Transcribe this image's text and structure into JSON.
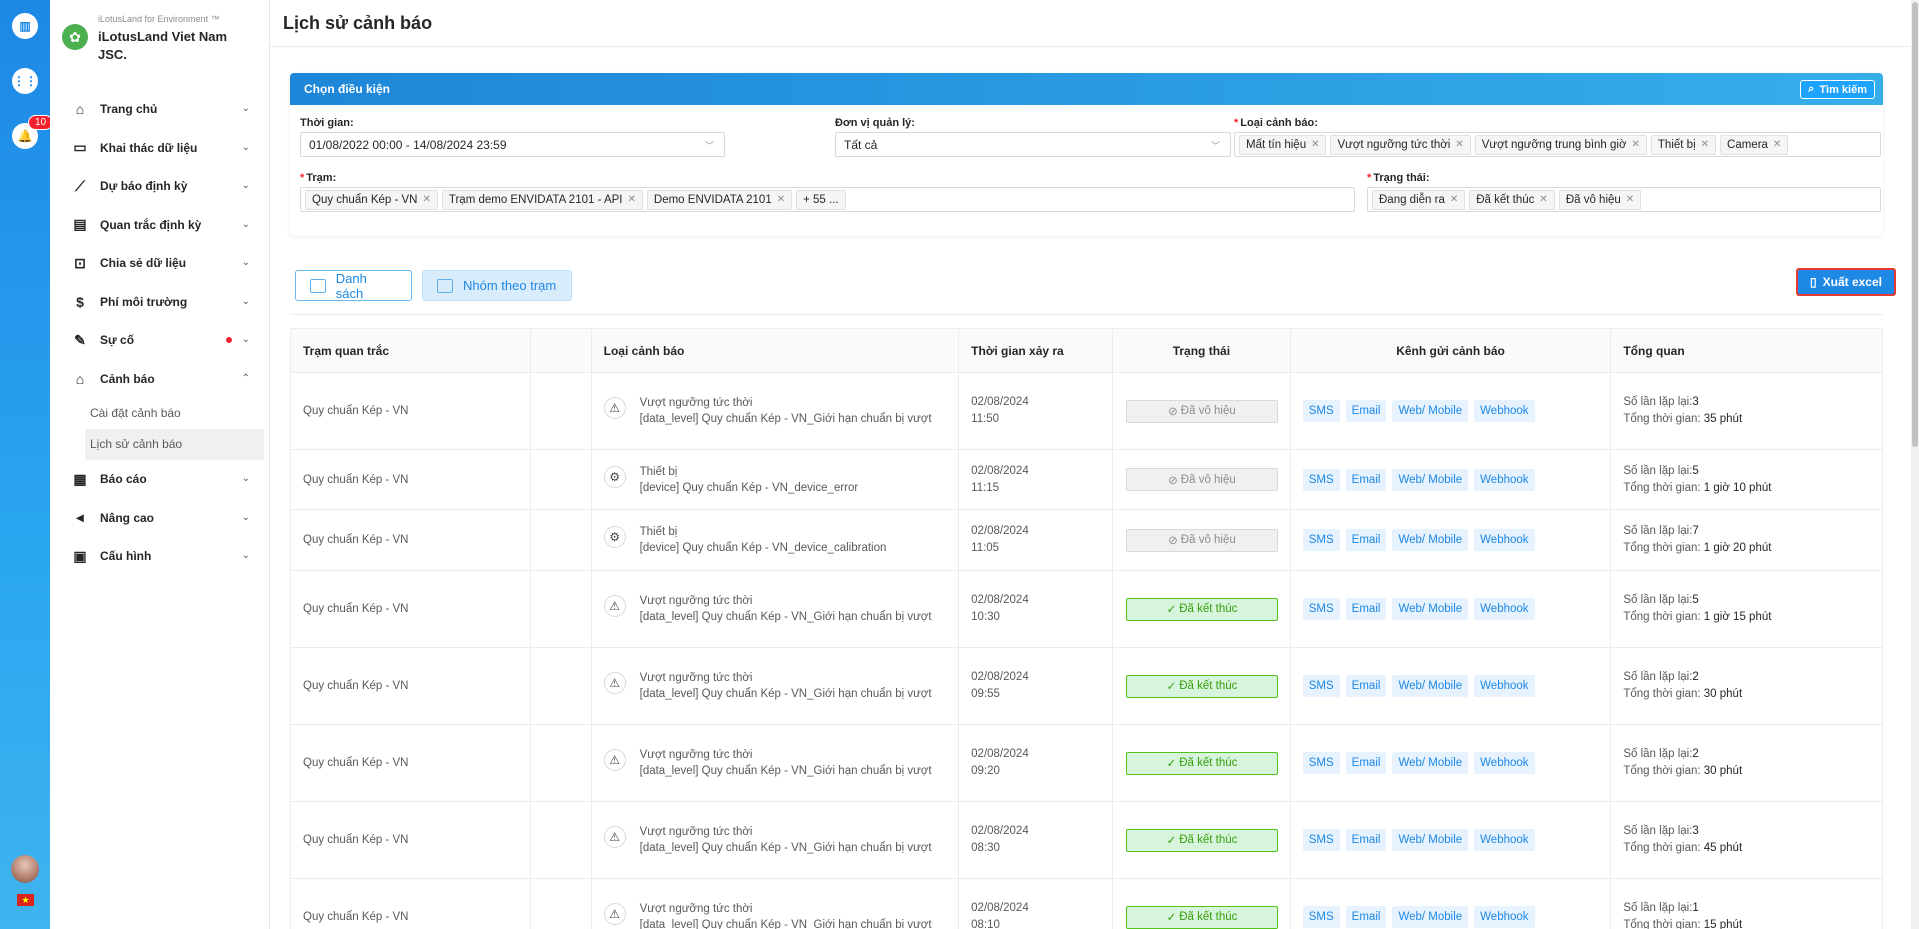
{
  "rail": {
    "notification_count": "10"
  },
  "brand": {
    "tagline": "iLotusLand for Environment ™",
    "name": "iLotusLand Viet Nam JSC."
  },
  "sidebar": {
    "items": [
      {
        "label": "Trang chủ",
        "icon": "home-icon"
      },
      {
        "label": "Khai thác dữ liệu",
        "icon": "monitor-icon"
      },
      {
        "label": "Dự báo định kỳ",
        "icon": "chart-icon"
      },
      {
        "label": "Quan trắc định kỳ",
        "icon": "clipboard-icon"
      },
      {
        "label": "Chia sẻ dữ liệu",
        "icon": "share-icon"
      },
      {
        "label": "Phí môi trường",
        "icon": "dollar-icon"
      },
      {
        "label": "Sự cố",
        "icon": "edit-icon"
      },
      {
        "label": "Cảnh báo",
        "icon": "bell-icon"
      },
      {
        "label": "Báo cáo",
        "icon": "report-icon"
      },
      {
        "label": "Nâng cao",
        "icon": "megaphone-icon"
      },
      {
        "label": "Cấu hình",
        "icon": "settings-icon"
      }
    ],
    "sub_items": [
      "Cài đặt cảnh báo",
      "Lịch sử cảnh báo"
    ]
  },
  "page": {
    "title": "Lịch sử cảnh báo"
  },
  "filter": {
    "header": "Chọn điều kiện",
    "search_label": "Tìm kiếm",
    "time_label": "Thời gian:",
    "time_value": "01/08/2022 00:00 - 14/08/2024 23:59",
    "unit_label": "Đơn vị quản lý:",
    "unit_value": "Tất cả",
    "alert_type_label": "Loại cảnh báo:",
    "alert_types": [
      "Mất tín hiệu",
      "Vượt ngưỡng tức thời",
      "Vượt ngưỡng trung bình giờ",
      "Thiết bị",
      "Camera"
    ],
    "station_label": "Trạm:",
    "stations": [
      "Quy chuẩn Kép - VN",
      "Trạm demo ENVIDATA 2101 - API",
      "Demo ENVIDATA 2101"
    ],
    "stations_more": "+ 55 ...",
    "status_label": "Trạng thái:",
    "statuses": [
      "Đang diễn ra",
      "Đã kết thúc",
      "Đã vô hiệu"
    ]
  },
  "views": {
    "list": "Danh sách",
    "group": "Nhóm theo trạm",
    "export": "Xuất excel"
  },
  "table": {
    "headers": [
      "Trạm quan trắc",
      "",
      "Loại cảnh báo",
      "Thời gian xảy ra",
      "Trạng thái",
      "Kênh gửi cảnh báo",
      "Tổng quan"
    ],
    "channels": [
      "SMS",
      "Email",
      "Web/ Mobile",
      "Webhook"
    ],
    "count_label": "Số lần lặp lại:",
    "duration_label": "Tổng thời gian:",
    "rows": [
      {
        "station": "Quy chuẩn Kép - VN",
        "icon": "warning-icon",
        "type": "Vượt ngưỡng tức thời",
        "detail": "[data_level] Quy chuẩn Kép - VN_Giới hạn chuẩn bị vượt",
        "date": "02/08/2024",
        "time": "11:50",
        "status": "Đã vô hiệu",
        "status_kind": "disabled",
        "count": "3",
        "duration": "35 phút"
      },
      {
        "station": "Quy chuẩn Kép - VN",
        "icon": "device-gear-icon",
        "type": "Thiết bị",
        "detail": "[device] Quy chuẩn Kép - VN_device_error",
        "date": "02/08/2024",
        "time": "11:15",
        "status": "Đã vô hiệu",
        "status_kind": "disabled",
        "count": "5",
        "duration": "1 giờ 10 phút"
      },
      {
        "station": "Quy chuẩn Kép - VN",
        "icon": "device-gear-icon",
        "type": "Thiết bị",
        "detail": "[device] Quy chuẩn Kép - VN_device_calibration",
        "date": "02/08/2024",
        "time": "11:05",
        "status": "Đã vô hiệu",
        "status_kind": "disabled",
        "count": "7",
        "duration": "1 giờ 20 phút"
      },
      {
        "station": "Quy chuẩn Kép - VN",
        "icon": "warning-icon",
        "type": "Vượt ngưỡng tức thời",
        "detail": "[data_level] Quy chuẩn Kép - VN_Giới hạn chuẩn bị vượt",
        "date": "02/08/2024",
        "time": "10:30",
        "status": "Đã kết thúc",
        "status_kind": "done",
        "count": "5",
        "duration": "1 giờ 15 phút"
      },
      {
        "station": "Quy chuẩn Kép - VN",
        "icon": "warning-icon",
        "type": "Vượt ngưỡng tức thời",
        "detail": "[data_level] Quy chuẩn Kép - VN_Giới hạn chuẩn bị vượt",
        "date": "02/08/2024",
        "time": "09:55",
        "status": "Đã kết thúc",
        "status_kind": "done",
        "count": "2",
        "duration": "30 phút"
      },
      {
        "station": "Quy chuẩn Kép - VN",
        "icon": "warning-icon",
        "type": "Vượt ngưỡng tức thời",
        "detail": "[data_level] Quy chuẩn Kép - VN_Giới hạn chuẩn bị vượt",
        "date": "02/08/2024",
        "time": "09:20",
        "status": "Đã kết thúc",
        "status_kind": "done",
        "count": "2",
        "duration": "30 phút"
      },
      {
        "station": "Quy chuẩn Kép - VN",
        "icon": "warning-icon",
        "type": "Vượt ngưỡng tức thời",
        "detail": "[data_level] Quy chuẩn Kép - VN_Giới hạn chuẩn bị vượt",
        "date": "02/08/2024",
        "time": "08:30",
        "status": "Đã kết thúc",
        "status_kind": "done",
        "count": "3",
        "duration": "45 phút"
      },
      {
        "station": "Quy chuẩn Kép - VN",
        "icon": "warning-icon",
        "type": "Vượt ngưỡng tức thời",
        "detail": "[data_level] Quy chuẩn Kép - VN_Giới hạn chuẩn bị vượt",
        "date": "02/08/2024",
        "time": "08:10",
        "status": "Đã kết thúc",
        "status_kind": "done",
        "count": "1",
        "duration": "15 phút"
      }
    ]
  },
  "colors": {
    "primary": "#1e88e5",
    "danger": "#f5222d",
    "success": "#52c41a"
  }
}
